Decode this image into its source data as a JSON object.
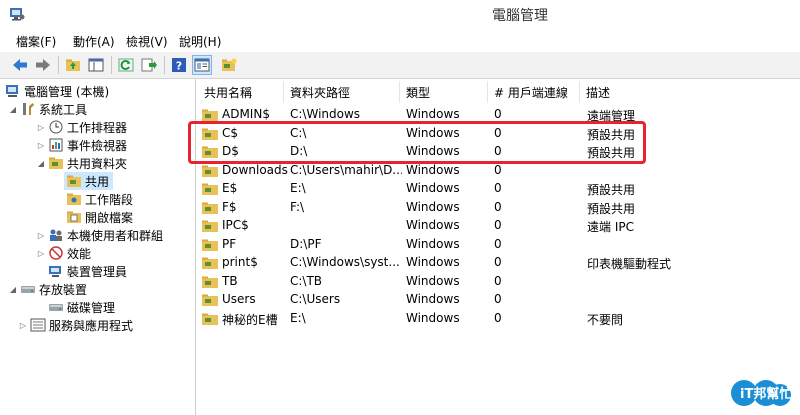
{
  "window": {
    "title": "電腦管理"
  },
  "menu": [
    "檔案(F)",
    "動作(A)",
    "檢視(V)",
    "說明(H)"
  ],
  "toolbar": [
    "back-icon",
    "forward-icon",
    "up-folder-icon",
    "show-hide-tree-icon",
    "refresh-icon",
    "export-list-icon",
    "help-icon",
    "properties-icon",
    "new-share-icon"
  ],
  "tree": [
    {
      "label": "電腦管理 (本機)",
      "icon": "computer-icon"
    },
    {
      "label": "系統工具",
      "icon": "tools-icon"
    },
    {
      "label": "工作排程器",
      "icon": "clock-icon"
    },
    {
      "label": "事件檢視器",
      "icon": "event-viewer-icon"
    },
    {
      "label": "共用資料夾",
      "icon": "shared-folder-icon"
    },
    {
      "label": "共用",
      "icon": "share-icon"
    },
    {
      "label": "工作階段",
      "icon": "session-icon"
    },
    {
      "label": "開啟檔案",
      "icon": "open-files-icon"
    },
    {
      "label": "本機使用者和群組",
      "icon": "users-icon"
    },
    {
      "label": "效能",
      "icon": "performance-icon"
    },
    {
      "label": "裝置管理員",
      "icon": "device-manager-icon"
    },
    {
      "label": "存放裝置",
      "icon": "storage-icon"
    },
    {
      "label": "磁碟管理",
      "icon": "disk-icon"
    },
    {
      "label": "服務與應用程式",
      "icon": "services-icon"
    }
  ],
  "columns": [
    "共用名稱",
    "資料夾路徑",
    "類型",
    "# 用戶端連線",
    "描述"
  ],
  "shares": [
    {
      "name": "ADMIN$",
      "path": "C:\\Windows",
      "type": "Windows",
      "clients": "0",
      "desc": "遠端管理"
    },
    {
      "name": "C$",
      "path": "C:\\",
      "type": "Windows",
      "clients": "0",
      "desc": "預設共用"
    },
    {
      "name": "D$",
      "path": "D:\\",
      "type": "Windows",
      "clients": "0",
      "desc": "預設共用"
    },
    {
      "name": "Downloads",
      "path": "C:\\Users\\mahir\\D...",
      "type": "Windows",
      "clients": "0",
      "desc": ""
    },
    {
      "name": "E$",
      "path": "E:\\",
      "type": "Windows",
      "clients": "0",
      "desc": "預設共用"
    },
    {
      "name": "F$",
      "path": "F:\\",
      "type": "Windows",
      "clients": "0",
      "desc": "預設共用"
    },
    {
      "name": "IPC$",
      "path": "",
      "type": "Windows",
      "clients": "0",
      "desc": "遠端 IPC"
    },
    {
      "name": "PF",
      "path": "D:\\PF",
      "type": "Windows",
      "clients": "0",
      "desc": ""
    },
    {
      "name": "print$",
      "path": "C:\\Windows\\syst...",
      "type": "Windows",
      "clients": "0",
      "desc": "印表機驅動程式"
    },
    {
      "name": "TB",
      "path": "C:\\TB",
      "type": "Windows",
      "clients": "0",
      "desc": ""
    },
    {
      "name": "Users",
      "path": "C:\\Users",
      "type": "Windows",
      "clients": "0",
      "desc": ""
    },
    {
      "name": "神秘的E槽",
      "path": "E:\\",
      "type": "Windows",
      "clients": "0",
      "desc": "不要問"
    }
  ],
  "watermark": "iT邦幫忙",
  "colors": {
    "highlight": "#e8232f",
    "selection": "#cce8ff",
    "watermark": "#1b8fd6"
  }
}
